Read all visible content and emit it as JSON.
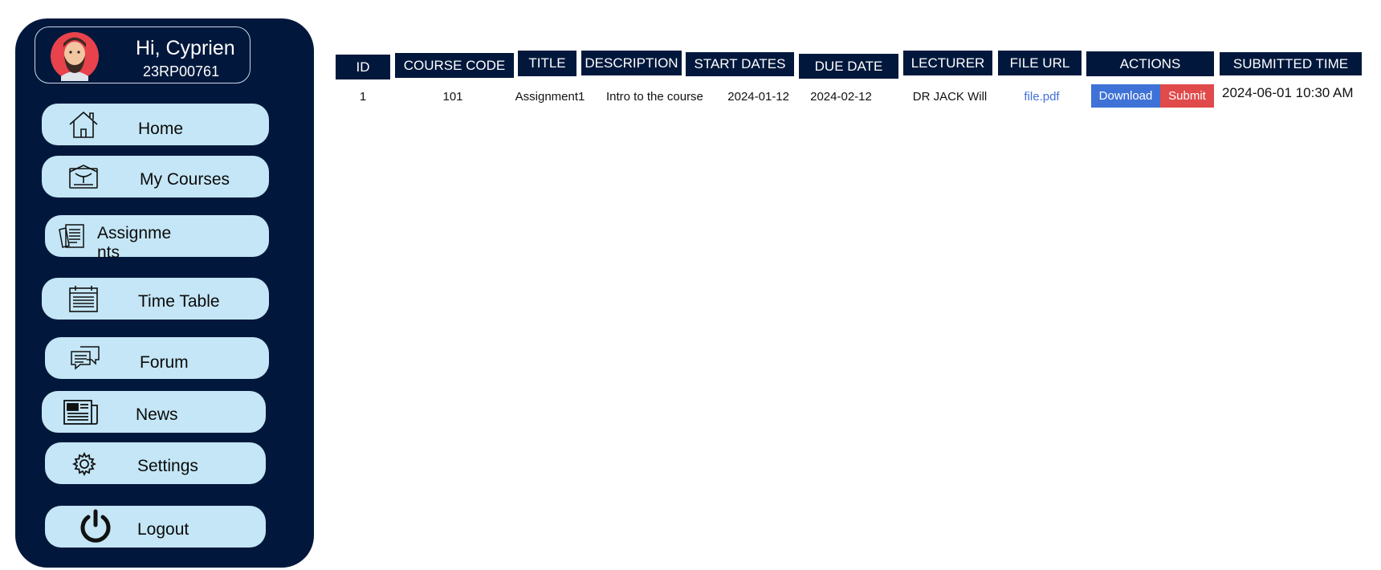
{
  "sidebar": {
    "profile": {
      "greeting": "Hi, Cyprien",
      "student_id": "23RP00761"
    },
    "items": [
      {
        "label": "Home",
        "icon": "home-icon"
      },
      {
        "label": "My Courses",
        "icon": "courses-icon"
      },
      {
        "label": "Assignme\nnts",
        "icon": "assignments-icon"
      },
      {
        "label": "Time Table",
        "icon": "calendar-icon"
      },
      {
        "label": "Forum",
        "icon": "chat-icon"
      },
      {
        "label": "News",
        "icon": "newspaper-icon"
      },
      {
        "label": "Settings",
        "icon": "gear-icon"
      },
      {
        "label": "Logout",
        "icon": "power-icon"
      }
    ]
  },
  "table": {
    "headers": [
      "ID",
      "COURSE CODE",
      "TITLE",
      "DESCRIPTION",
      "START DATES",
      "DUE DATE",
      "LECTURER",
      "FILE URL",
      "ACTIONS",
      "SUBMITTED TIME"
    ],
    "rows": [
      {
        "id": "1",
        "course_code": "101",
        "title": "Assignment1",
        "description": "Intro to the course",
        "start_date": "2024-01-12",
        "due_date": "2024-02-12",
        "lecturer": "DR JACK Will",
        "file_url": "file.pdf",
        "download_label": "Download",
        "submit_label": "Submit",
        "submitted_time": "2024-06-01 10:30 AM"
      }
    ]
  },
  "colors": {
    "navy": "#01183c",
    "nav_item_bg": "#c4e6f6",
    "download_button": "#3f72d7",
    "submit_button": "#e04a4a",
    "link": "#4470d9"
  }
}
